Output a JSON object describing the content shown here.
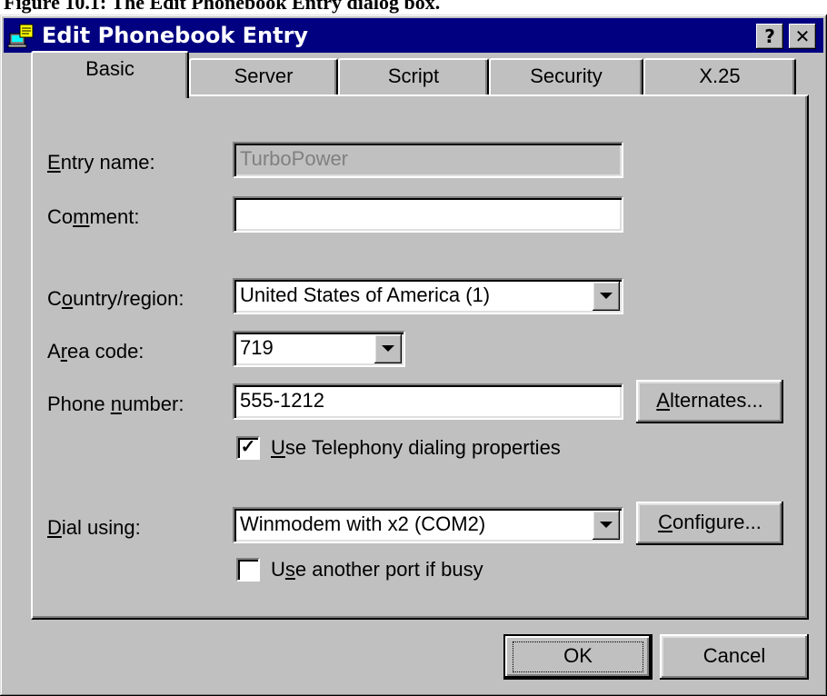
{
  "window": {
    "title": "Edit Phonebook Entry",
    "help_glyph": "?",
    "close_glyph": "✕",
    "icon": "phonebook-icon"
  },
  "top_strip_text": "Figure 10.1: The Edit Phonebook Entry dialog box.",
  "tabs": [
    {
      "label": "Basic",
      "active": true
    },
    {
      "label": "Server",
      "active": false
    },
    {
      "label": "Script",
      "active": false
    },
    {
      "label": "Security",
      "active": false
    },
    {
      "label": "X.25",
      "active": false
    }
  ],
  "form": {
    "entry_name": {
      "label_u": "E",
      "label_rest": "ntry name:",
      "value": "TurboPower",
      "disabled": true
    },
    "comment": {
      "label_pre": "Co",
      "label_u": "m",
      "label_rest": "ment:",
      "value": ""
    },
    "country": {
      "label_pre": "C",
      "label_u": "o",
      "label_rest": "untry/region:",
      "value": "United States of America (1)"
    },
    "area_code": {
      "label_pre": "A",
      "label_u": "r",
      "label_rest": "ea code:",
      "value": "719"
    },
    "phone": {
      "label_pre": "Phone ",
      "label_u": "n",
      "label_rest": "umber:",
      "value": "555-1212"
    },
    "use_telephony": {
      "label_u": "U",
      "label_rest": "se Telephony dialing properties",
      "checked": true
    },
    "dial_using": {
      "label_u": "D",
      "label_rest": "ial using:",
      "value": "Winmodem with x2 (COM2)"
    },
    "another_port": {
      "label_pre": "U",
      "label_u": "s",
      "label_rest": "e another port if busy",
      "checked": false
    }
  },
  "buttons": {
    "alternates": {
      "label_u": "A",
      "label_rest": "lternates..."
    },
    "configure": {
      "label_u": "C",
      "label_rest": "onfigure..."
    },
    "ok": "OK",
    "cancel": "Cancel"
  }
}
